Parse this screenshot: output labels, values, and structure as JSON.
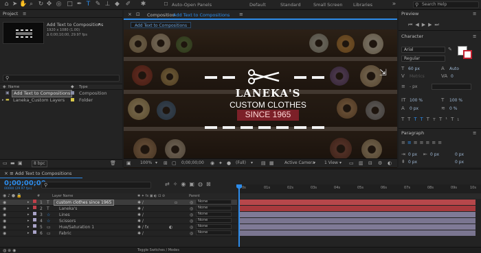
{
  "toolbar": {
    "auto_open_label": "Auto-Open Panels",
    "workspaces": [
      "Default",
      "Standard",
      "Small Screen",
      "Libraries"
    ],
    "search_help_placeholder": "Search Help"
  },
  "project": {
    "title": "Project",
    "selected_name": "Add Text to Compositions",
    "selected_info_line1": "1920 x 1080 (1.00)",
    "selected_info_line2": "Δ 0;00;10;00, 29.97 fps",
    "col_name": "Name",
    "col_type": "Type",
    "items": [
      {
        "name": "Add Text to Compositions",
        "type": "Composition",
        "color": "#8a8fa8"
      },
      {
        "name": "Laneka_Custom Layers",
        "type": "Folder",
        "color": "#d8c84a"
      }
    ],
    "bpc": "8 bpc"
  },
  "composition": {
    "tab_prefix": "Composition",
    "tab_name": "Add Text to Compositions",
    "crumb": "Add Text to Compositions",
    "text_line1": "LANEKA'S",
    "text_line2": "CUSTOM CLOTHES",
    "text_line3": "SINCE 1965",
    "zoom": "100%",
    "timecode": "0;00;00;00",
    "resolution": "(Full)",
    "camera": "Active Camera",
    "view": "1 View"
  },
  "right": {
    "preview_title": "Preview",
    "character_title": "Character",
    "font_family": "Arial",
    "font_style": "Regular",
    "font_size": "60 px",
    "leading": "Auto",
    "tracking": "0",
    "stroke_unit": "- px",
    "vscale": "100 %",
    "hscale": "100 %",
    "baseline": "0 px",
    "tsume": "0 %",
    "paragraph_title": "Paragraph",
    "indent_values": [
      "0 px",
      "0 px",
      "0 px",
      "0 px",
      "0 px"
    ]
  },
  "timeline": {
    "tab_label": "Add Text to Compositions",
    "timecode": "0;00;00;00",
    "fps": "00000 (29.97 fps)",
    "header_layer_name": "Layer Name",
    "header_parent": "Parent",
    "layers": [
      {
        "num": "1",
        "name": "custom clothes since 1965",
        "type": "T",
        "color": "#c0404a",
        "parent": "None",
        "bar": "#b7474b"
      },
      {
        "num": "2",
        "name": "Laneka's",
        "type": "T",
        "color": "#c0404a",
        "parent": "None",
        "bar": "#b7474b"
      },
      {
        "num": "3",
        "name": "Lines",
        "type": "☆",
        "color": "#a9a3c8",
        "parent": "None",
        "bar": "#7f7a96"
      },
      {
        "num": "4",
        "name": "Scissors",
        "type": "☆",
        "color": "#a9a3c8",
        "parent": "None",
        "bar": "#7f7a96"
      },
      {
        "num": "5",
        "name": "Hue/Saturation 1",
        "type": "▭",
        "color": "#a9a3c8",
        "parent": "None",
        "bar": "#7f7a96"
      },
      {
        "num": "6",
        "name": "Fabric",
        "type": "▭",
        "color": "#a9a3c8",
        "parent": "None",
        "bar": "#7f7a96"
      }
    ],
    "ruler_ticks": [
      "0s",
      "01s",
      "02s",
      "03s",
      "04s",
      "05s",
      "06s",
      "07s",
      "08s",
      "09s",
      "10s"
    ],
    "toggle_label": "Toggle Switches / Modes"
  },
  "colors": {
    "accent": "#2d8ceb",
    "panel": "#232323",
    "bg": "#1d1d1d"
  }
}
